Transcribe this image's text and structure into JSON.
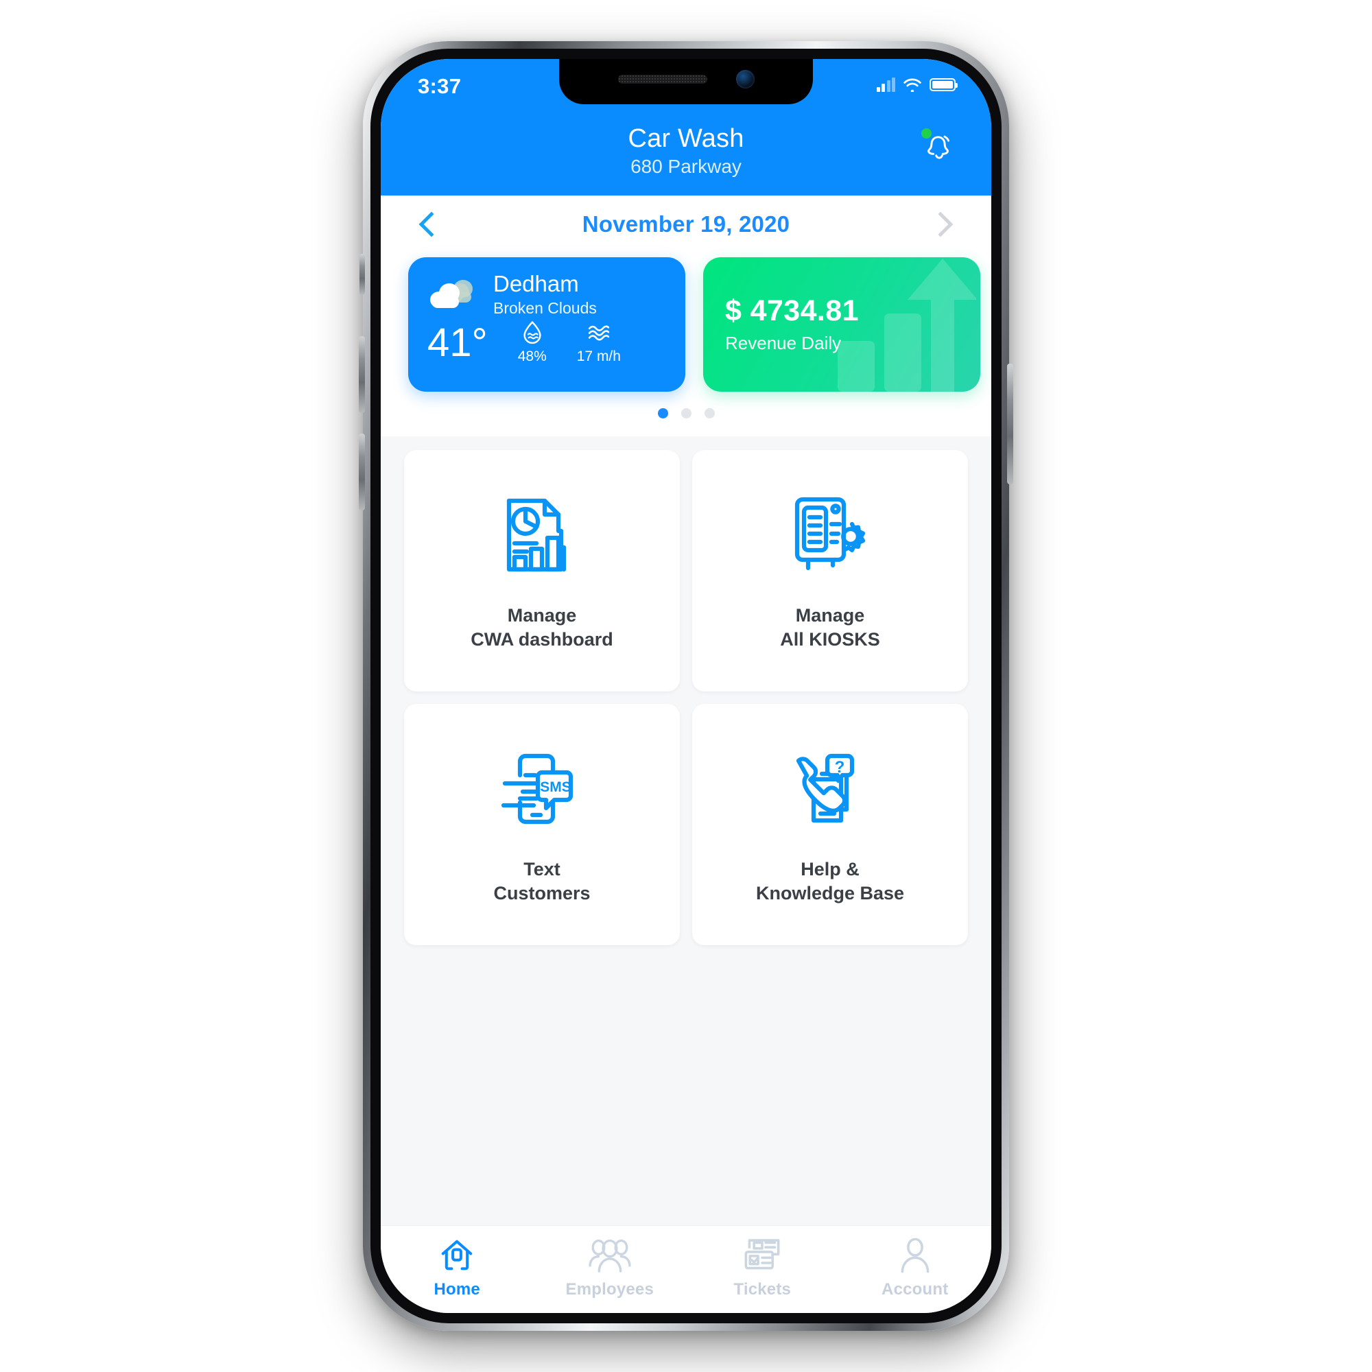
{
  "status_bar": {
    "time": "3:37",
    "signal_icon": "cellular-signal-icon",
    "wifi_icon": "wifi-icon",
    "battery_icon": "battery-icon"
  },
  "header": {
    "title": "Car Wash",
    "subtitle": "680 Parkway",
    "notification_icon": "bell-icon",
    "notification_dot_color": "#22d14a",
    "background_color": "#0a8cff"
  },
  "date_nav": {
    "prev_icon": "chevron-left-icon",
    "next_icon": "chevron-right-icon",
    "date": "November 19, 2020",
    "date_color": "#1a8cff"
  },
  "carousel": {
    "weather": {
      "icon": "cloudy-icon",
      "city": "Dedham",
      "condition": "Broken Clouds",
      "temperature": "41°",
      "humidity_icon": "humidity-droplet-icon",
      "humidity": "48%",
      "wind_icon": "wind-waves-icon",
      "wind": "17 m/h",
      "background_color": "#0a8cff"
    },
    "revenue": {
      "value": "$ 4734.81",
      "label": "Revenue Daily",
      "decoration_icon": "growth-arrow-bars-icon",
      "gradient_from": "#00e57d",
      "gradient_to": "#2ad4ad"
    },
    "dots": {
      "count": 3,
      "active_index": 0
    }
  },
  "menu": {
    "tiles": [
      {
        "icon": "report-chart-document-icon",
        "line1": "Manage",
        "line2": "CWA dashboard"
      },
      {
        "icon": "kiosk-settings-icon",
        "line1": "Manage",
        "line2": "All KIOSKS"
      },
      {
        "icon": "sms-phone-icon",
        "line1": "Text",
        "line2": "Customers"
      },
      {
        "icon": "phone-help-docs-icon",
        "line1": "Help &",
        "line2": "Knowledge Base"
      }
    ]
  },
  "tabbar": {
    "active_color": "#0a8cff",
    "inactive_color": "#c7d0db",
    "tabs": [
      {
        "icon": "home-icon",
        "label": "Home",
        "active": true
      },
      {
        "icon": "employees-icon",
        "label": "Employees",
        "active": false
      },
      {
        "icon": "tickets-icon",
        "label": "Tickets",
        "active": false
      },
      {
        "icon": "account-icon",
        "label": "Account",
        "active": false
      }
    ]
  }
}
